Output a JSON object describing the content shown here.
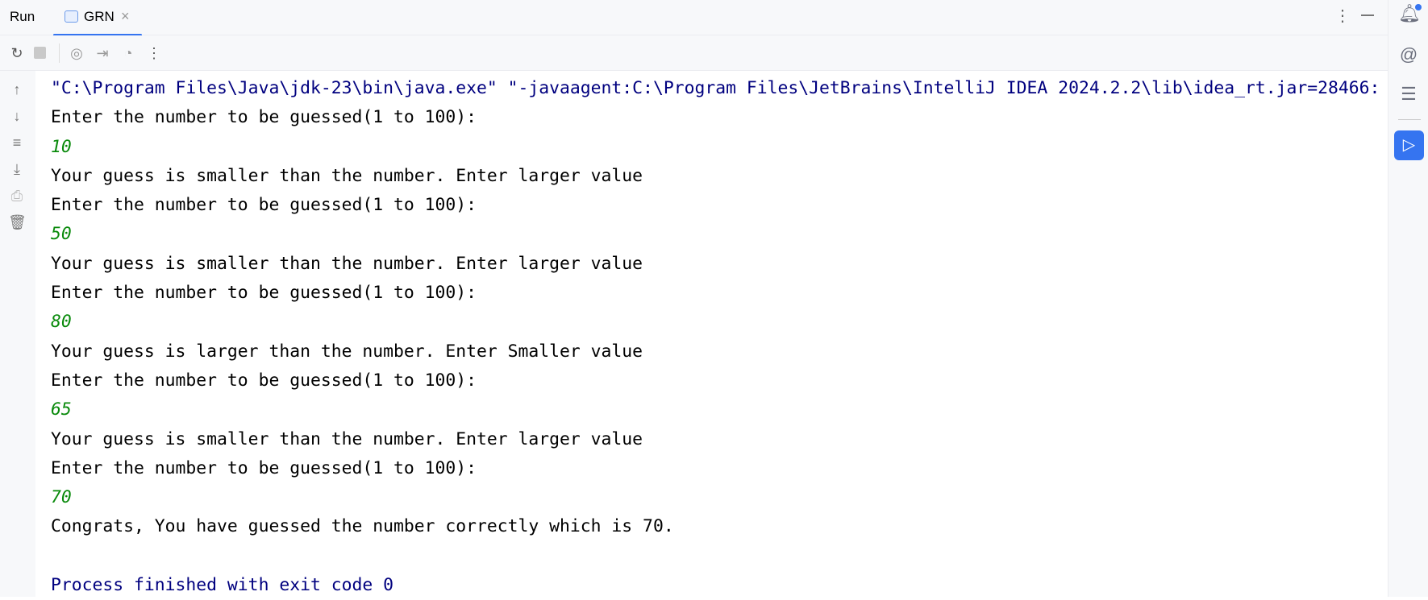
{
  "header": {
    "run_label": "Run",
    "tab_label": "GRN"
  },
  "console": {
    "lines": [
      {
        "t": "\"C:\\Program Files\\Java\\jdk-23\\bin\\java.exe\" \"-javaagent:C:\\Program Files\\JetBrains\\IntelliJ IDEA 2024.2.2\\lib\\idea_rt.jar=28466:",
        "k": "cmd"
      },
      {
        "t": "Enter the number to be guessed(1 to 100):",
        "k": "out"
      },
      {
        "t": "10",
        "k": "inp"
      },
      {
        "t": "Your guess is smaller than the number. Enter larger value",
        "k": "out"
      },
      {
        "t": "Enter the number to be guessed(1 to 100):",
        "k": "out"
      },
      {
        "t": "50",
        "k": "inp"
      },
      {
        "t": "Your guess is smaller than the number. Enter larger value",
        "k": "out"
      },
      {
        "t": "Enter the number to be guessed(1 to 100):",
        "k": "out"
      },
      {
        "t": "80",
        "k": "inp"
      },
      {
        "t": "Your guess is larger than the number. Enter Smaller value",
        "k": "out"
      },
      {
        "t": "Enter the number to be guessed(1 to 100):",
        "k": "out"
      },
      {
        "t": "65",
        "k": "inp"
      },
      {
        "t": "Your guess is smaller than the number. Enter larger value",
        "k": "out"
      },
      {
        "t": "Enter the number to be guessed(1 to 100):",
        "k": "out"
      },
      {
        "t": "70",
        "k": "inp"
      },
      {
        "t": "Congrats, You have guessed the number correctly which is 70.",
        "k": "out"
      },
      {
        "t": "",
        "k": "out"
      },
      {
        "t": "Process finished with exit code 0",
        "k": "fin"
      }
    ]
  },
  "colors": {
    "accent": "#3574f0",
    "input": "#098a0b",
    "command": "#00007f"
  }
}
